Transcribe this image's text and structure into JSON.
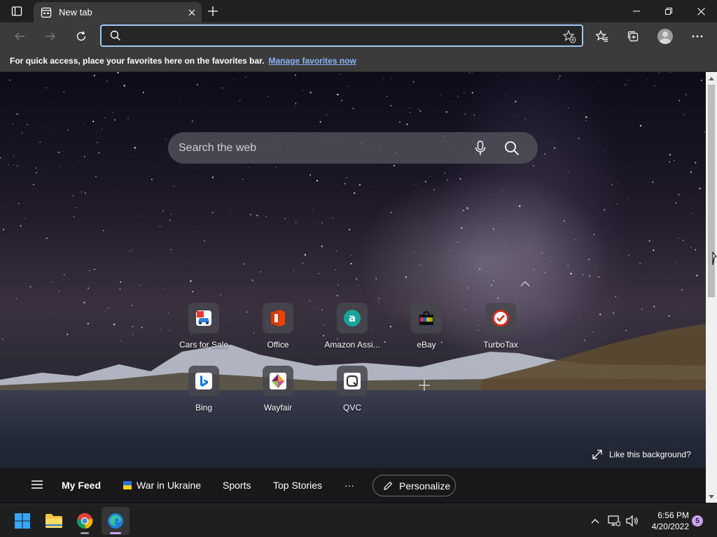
{
  "browser": {
    "tab_title": "New tab",
    "address_value": "",
    "favorites_bar": {
      "message": "For quick access, place your favorites here on the favorites bar.",
      "link": "Manage favorites now"
    }
  },
  "newtab": {
    "search_placeholder": "Search the web",
    "tiles": [
      {
        "label": "Cars for Sale",
        "icon": "cars-for-sale-icon"
      },
      {
        "label": "Office",
        "icon": "office-icon"
      },
      {
        "label": "Amazon Assi...",
        "icon": "amazon-assistant-icon"
      },
      {
        "label": "eBay",
        "icon": "ebay-icon"
      },
      {
        "label": "TurboTax",
        "icon": "turbotax-icon"
      },
      {
        "label": "Bing",
        "icon": "bing-icon"
      },
      {
        "label": "Wayfair",
        "icon": "wayfair-icon"
      },
      {
        "label": "QVC",
        "icon": "qvc-icon"
      }
    ],
    "like_background": "Like this background?",
    "feed": {
      "my_feed": "My Feed",
      "items": [
        "War in Ukraine",
        "Sports",
        "Top Stories"
      ],
      "more": "···",
      "personalize": "Personalize"
    }
  },
  "taskbar": {
    "time": "6:56 PM",
    "date": "4/20/2022",
    "notification_count": "5"
  },
  "colors": {
    "accent_focus": "#9ec8f0",
    "link": "#8ab4f8",
    "taskbar_indicator": "#c9a0f0"
  }
}
